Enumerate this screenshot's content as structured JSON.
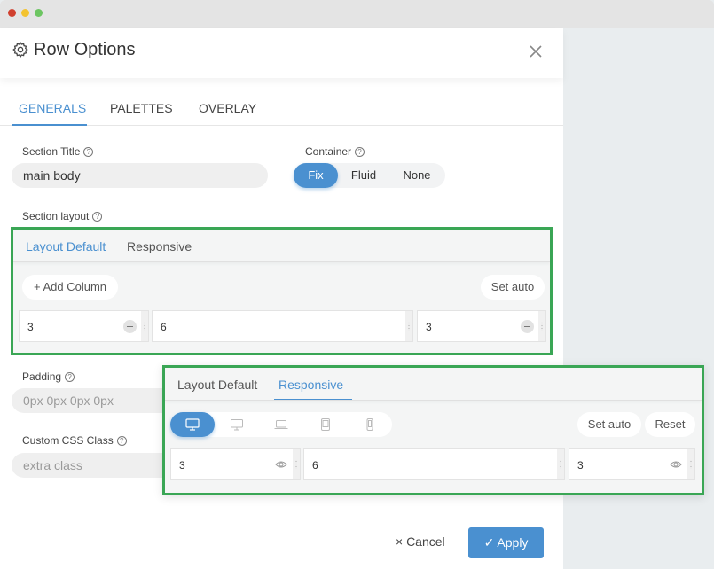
{
  "window": {
    "controls": [
      "close",
      "minimize",
      "maximize"
    ]
  },
  "dialog": {
    "title": "Row Options",
    "tabs": [
      {
        "label": "GENERALS",
        "active": true
      },
      {
        "label": "PALETTES",
        "active": false
      },
      {
        "label": "OVERLAY",
        "active": false
      }
    ]
  },
  "generals": {
    "section_title": {
      "label": "Section Title",
      "value": "main body"
    },
    "container": {
      "label": "Container",
      "options": [
        "Fix",
        "Fluid",
        "None"
      ],
      "selected": "Fix"
    },
    "section_layout": {
      "label": "Section layout",
      "tabs": [
        {
          "label": "Layout Default",
          "active": true
        },
        {
          "label": "Responsive",
          "active": false
        }
      ],
      "add_column_label": "+ Add Column",
      "set_auto_label": "Set auto",
      "columns": [
        "3",
        "6",
        "3"
      ]
    },
    "padding": {
      "label": "Padding",
      "placeholder": "0px 0px 0px 0px"
    },
    "custom_css": {
      "label": "Custom CSS Class",
      "placeholder": "extra class"
    }
  },
  "responsive_popup": {
    "tabs": [
      {
        "label": "Layout Default",
        "active": false
      },
      {
        "label": "Responsive",
        "active": true
      }
    ],
    "devices": [
      "large-desktop",
      "desktop",
      "laptop",
      "tablet",
      "mobile"
    ],
    "selected_device": "large-desktop",
    "set_auto_label": "Set auto",
    "reset_label": "Reset",
    "columns": [
      "3",
      "6",
      "3"
    ]
  },
  "footer": {
    "cancel_label": "× Cancel",
    "apply_label": "✓ Apply"
  },
  "colors": {
    "accent": "#4a90d0",
    "highlight_border": "#3aa655"
  }
}
